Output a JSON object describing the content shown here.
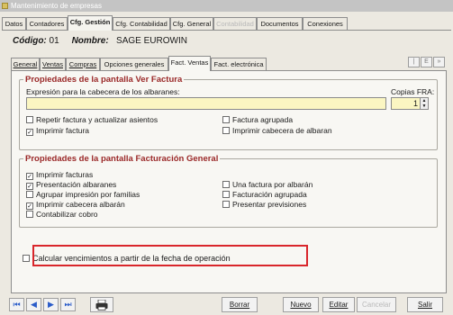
{
  "window": {
    "title": "Mantenimiento de empresas"
  },
  "main_tabs": [
    {
      "label": "Datos"
    },
    {
      "label": "Contadores"
    },
    {
      "label": "Cfg. Gestión"
    },
    {
      "label": "Cfg. Contabilidad"
    },
    {
      "label": "Cfg. General"
    },
    {
      "label": "Contabilidad"
    },
    {
      "label": "Documentos"
    },
    {
      "label": "Conexiones"
    }
  ],
  "main_tabs_active_index": 2,
  "company": {
    "code_label": "Código:",
    "code_value": "01",
    "name_label": "Nombre:",
    "name_value": "SAGE EUROWIN"
  },
  "sub_tabs": [
    {
      "label": "General"
    },
    {
      "label": "Ventas"
    },
    {
      "label": "Compras"
    },
    {
      "label": "Opciones generales"
    },
    {
      "label": "Fact. Ventas"
    },
    {
      "label": "Fact. electrónica"
    }
  ],
  "sub_tabs_active_index": 4,
  "sub_tab_nav": [
    "|",
    "E",
    "»"
  ],
  "ver_factura": {
    "title": "Propiedades de la pantalla Ver Factura",
    "expression_label": "Expresión para la cabecera de los albaranes:",
    "expression_value": "",
    "copias_label": "Copias FRA:",
    "copias_value": "1",
    "checkboxes": [
      {
        "label": "Repetir factura y actualizar asientos",
        "checked": false
      },
      {
        "label": "Imprimir factura",
        "checked": true
      },
      {
        "label": "Factura agrupada",
        "checked": false
      },
      {
        "label": "Imprimir cabecera de albaran",
        "checked": false
      }
    ]
  },
  "facturacion_general": {
    "title": "Propiedades de la pantalla Facturación General",
    "checkboxes_left": [
      {
        "label": "Imprimir facturas",
        "checked": true
      },
      {
        "label": "Presentación albaranes",
        "checked": true
      },
      {
        "label": "Agrupar impresión por familias",
        "checked": false
      },
      {
        "label": "Imprimir cabecera albarán",
        "checked": true
      },
      {
        "label": "Contabilizar cobro",
        "checked": false
      }
    ],
    "checkboxes_right": [
      {
        "label": "Una factura por albarán",
        "checked": false
      },
      {
        "label": "Facturación agrupada",
        "checked": false
      },
      {
        "label": "Presentar previsiones",
        "checked": false
      }
    ]
  },
  "calcular_vencimientos": {
    "label": "Calcular vencimientos a partir de la fecha de operación",
    "checked": false
  },
  "highlight_color": "#d9262b",
  "toolbar": {
    "nav_first": "⏮",
    "nav_prev": "◀",
    "nav_next": "▶",
    "nav_last": "⏭",
    "print_icon": "printer-icon",
    "borrar": "Borrar",
    "nuevo": "Nuevo",
    "editar": "Editar",
    "cancelar": "Cancelar",
    "salir": "Salir"
  },
  "colors": {
    "accent": "#9a2828",
    "nav": "#2a5cc9",
    "input_bg": "#fbf6c2"
  }
}
